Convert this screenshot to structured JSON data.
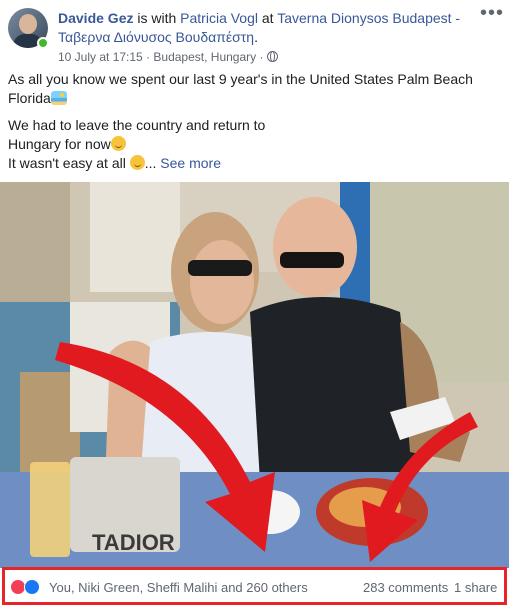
{
  "post": {
    "author": "Davide Gez",
    "with_text": " is with ",
    "tagged_person": "Patricia Vogl",
    "at_text": " at ",
    "place": "Taverna Dionysos Budapest - Ταβερνα Διόνυσος Βουδαπέστη",
    "place_end": ".",
    "date": "10 July at 17:15",
    "separator": " · ",
    "location": "Budapest, Hungary",
    "text_line1": "As all you know we spent our last 9 year's in the United States Palm Beach Florida",
    "text_line2a": "We had to leave the country and return to",
    "text_line2b": "Hungary for now",
    "text_line3": "It wasn't easy at all ",
    "ellipsis": "... ",
    "see_more": "See more",
    "more_options": "•••",
    "bag_text": "TADIOR"
  },
  "reactions": {
    "reactors": "You, Niki Green, Sheffi Malihi and 260 others",
    "comments": "283 comments",
    "shares": "1 share"
  },
  "icons": [
    "globe-icon",
    "heart-reaction-icon",
    "like-reaction-icon",
    "beach-emoji",
    "smile-emoji",
    "upside-down-face-emoji"
  ],
  "colors": {
    "link": "#385898",
    "highlight_box": "#e8242b",
    "arrow": "#e01a1f",
    "heart": "#f33e58",
    "like": "#1877f2"
  }
}
